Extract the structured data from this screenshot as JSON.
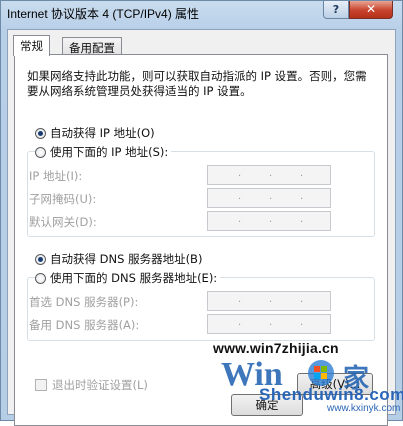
{
  "window": {
    "title": "Internet 协议版本 4 (TCP/IPv4) 属性",
    "help_label": "?",
    "close_label": "✕"
  },
  "tabs": [
    {
      "label": "常规",
      "active": true
    },
    {
      "label": "备用配置",
      "active": false
    }
  ],
  "description": "如果网络支持此功能，则可以获取自动指派的 IP 设置。否则，您需要从网络系统管理员处获得适当的 IP 设置。",
  "ip_section": {
    "auto_label": "自动获得 IP 地址(O)",
    "manual_label": "使用下面的 IP 地址(S):",
    "selected": "auto",
    "fields": [
      {
        "label": "IP 地址(I):",
        "value": ". . ."
      },
      {
        "label": "子网掩码(U):",
        "value": ". . ."
      },
      {
        "label": "默认网关(D):",
        "value": ". . ."
      }
    ]
  },
  "dns_section": {
    "auto_label": "自动获得 DNS 服务器地址(B)",
    "manual_label": "使用下面的 DNS 服务器地址(E):",
    "selected": "auto",
    "fields": [
      {
        "label": "首选 DNS 服务器(P):",
        "value": ". . ."
      },
      {
        "label": "备用 DNS 服务器(A):",
        "value": ". . ."
      }
    ]
  },
  "validate_checkbox": {
    "label": "退出时验证设置(L)",
    "checked": false
  },
  "advanced_button": "高级(V)...",
  "ok_button": "确定",
  "watermark": {
    "url": "www.win7zhijia.cn",
    "site": "Shenduwin8.com",
    "sub": "www.kxinyk.com"
  }
}
